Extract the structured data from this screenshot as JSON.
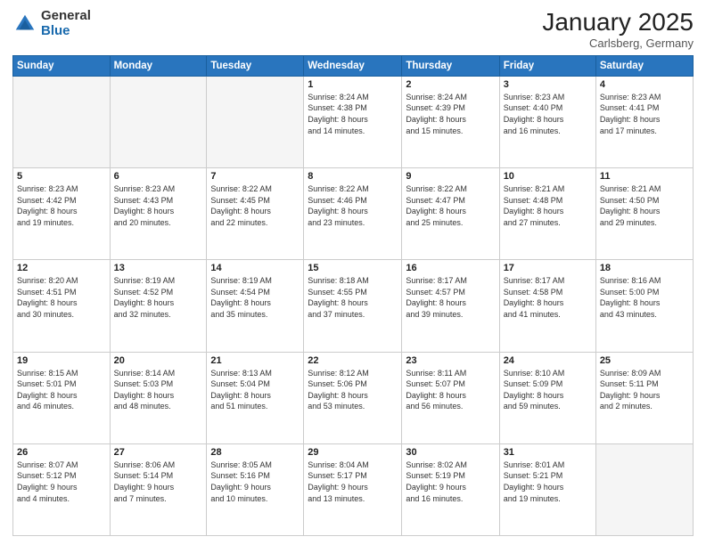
{
  "logo": {
    "general": "General",
    "blue": "Blue"
  },
  "header": {
    "month": "January 2025",
    "location": "Carlsberg, Germany"
  },
  "days_of_week": [
    "Sunday",
    "Monday",
    "Tuesday",
    "Wednesday",
    "Thursday",
    "Friday",
    "Saturday"
  ],
  "weeks": [
    [
      {
        "day": "",
        "info": ""
      },
      {
        "day": "",
        "info": ""
      },
      {
        "day": "",
        "info": ""
      },
      {
        "day": "1",
        "info": "Sunrise: 8:24 AM\nSunset: 4:38 PM\nDaylight: 8 hours\nand 14 minutes."
      },
      {
        "day": "2",
        "info": "Sunrise: 8:24 AM\nSunset: 4:39 PM\nDaylight: 8 hours\nand 15 minutes."
      },
      {
        "day": "3",
        "info": "Sunrise: 8:23 AM\nSunset: 4:40 PM\nDaylight: 8 hours\nand 16 minutes."
      },
      {
        "day": "4",
        "info": "Sunrise: 8:23 AM\nSunset: 4:41 PM\nDaylight: 8 hours\nand 17 minutes."
      }
    ],
    [
      {
        "day": "5",
        "info": "Sunrise: 8:23 AM\nSunset: 4:42 PM\nDaylight: 8 hours\nand 19 minutes."
      },
      {
        "day": "6",
        "info": "Sunrise: 8:23 AM\nSunset: 4:43 PM\nDaylight: 8 hours\nand 20 minutes."
      },
      {
        "day": "7",
        "info": "Sunrise: 8:22 AM\nSunset: 4:45 PM\nDaylight: 8 hours\nand 22 minutes."
      },
      {
        "day": "8",
        "info": "Sunrise: 8:22 AM\nSunset: 4:46 PM\nDaylight: 8 hours\nand 23 minutes."
      },
      {
        "day": "9",
        "info": "Sunrise: 8:22 AM\nSunset: 4:47 PM\nDaylight: 8 hours\nand 25 minutes."
      },
      {
        "day": "10",
        "info": "Sunrise: 8:21 AM\nSunset: 4:48 PM\nDaylight: 8 hours\nand 27 minutes."
      },
      {
        "day": "11",
        "info": "Sunrise: 8:21 AM\nSunset: 4:50 PM\nDaylight: 8 hours\nand 29 minutes."
      }
    ],
    [
      {
        "day": "12",
        "info": "Sunrise: 8:20 AM\nSunset: 4:51 PM\nDaylight: 8 hours\nand 30 minutes."
      },
      {
        "day": "13",
        "info": "Sunrise: 8:19 AM\nSunset: 4:52 PM\nDaylight: 8 hours\nand 32 minutes."
      },
      {
        "day": "14",
        "info": "Sunrise: 8:19 AM\nSunset: 4:54 PM\nDaylight: 8 hours\nand 35 minutes."
      },
      {
        "day": "15",
        "info": "Sunrise: 8:18 AM\nSunset: 4:55 PM\nDaylight: 8 hours\nand 37 minutes."
      },
      {
        "day": "16",
        "info": "Sunrise: 8:17 AM\nSunset: 4:57 PM\nDaylight: 8 hours\nand 39 minutes."
      },
      {
        "day": "17",
        "info": "Sunrise: 8:17 AM\nSunset: 4:58 PM\nDaylight: 8 hours\nand 41 minutes."
      },
      {
        "day": "18",
        "info": "Sunrise: 8:16 AM\nSunset: 5:00 PM\nDaylight: 8 hours\nand 43 minutes."
      }
    ],
    [
      {
        "day": "19",
        "info": "Sunrise: 8:15 AM\nSunset: 5:01 PM\nDaylight: 8 hours\nand 46 minutes."
      },
      {
        "day": "20",
        "info": "Sunrise: 8:14 AM\nSunset: 5:03 PM\nDaylight: 8 hours\nand 48 minutes."
      },
      {
        "day": "21",
        "info": "Sunrise: 8:13 AM\nSunset: 5:04 PM\nDaylight: 8 hours\nand 51 minutes."
      },
      {
        "day": "22",
        "info": "Sunrise: 8:12 AM\nSunset: 5:06 PM\nDaylight: 8 hours\nand 53 minutes."
      },
      {
        "day": "23",
        "info": "Sunrise: 8:11 AM\nSunset: 5:07 PM\nDaylight: 8 hours\nand 56 minutes."
      },
      {
        "day": "24",
        "info": "Sunrise: 8:10 AM\nSunset: 5:09 PM\nDaylight: 8 hours\nand 59 minutes."
      },
      {
        "day": "25",
        "info": "Sunrise: 8:09 AM\nSunset: 5:11 PM\nDaylight: 9 hours\nand 2 minutes."
      }
    ],
    [
      {
        "day": "26",
        "info": "Sunrise: 8:07 AM\nSunset: 5:12 PM\nDaylight: 9 hours\nand 4 minutes."
      },
      {
        "day": "27",
        "info": "Sunrise: 8:06 AM\nSunset: 5:14 PM\nDaylight: 9 hours\nand 7 minutes."
      },
      {
        "day": "28",
        "info": "Sunrise: 8:05 AM\nSunset: 5:16 PM\nDaylight: 9 hours\nand 10 minutes."
      },
      {
        "day": "29",
        "info": "Sunrise: 8:04 AM\nSunset: 5:17 PM\nDaylight: 9 hours\nand 13 minutes."
      },
      {
        "day": "30",
        "info": "Sunrise: 8:02 AM\nSunset: 5:19 PM\nDaylight: 9 hours\nand 16 minutes."
      },
      {
        "day": "31",
        "info": "Sunrise: 8:01 AM\nSunset: 5:21 PM\nDaylight: 9 hours\nand 19 minutes."
      },
      {
        "day": "",
        "info": ""
      }
    ]
  ]
}
